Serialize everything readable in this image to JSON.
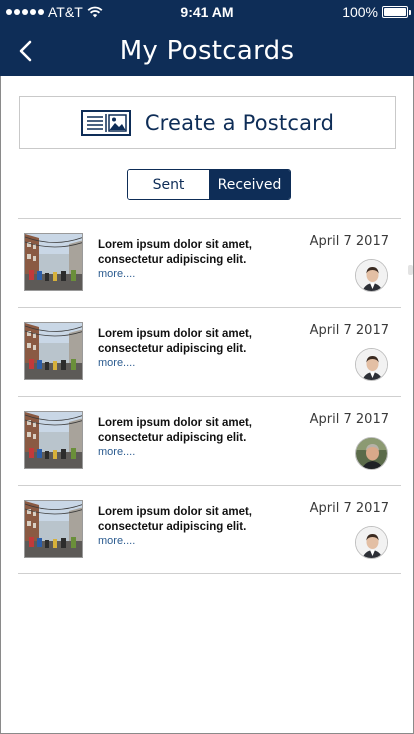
{
  "status": {
    "carrier": "AT&T",
    "time": "9:41 AM",
    "battery": "100%",
    "battery_level": 1.0
  },
  "nav": {
    "title": "My Postcards",
    "back_icon": "chevron-left-icon"
  },
  "create_button": {
    "label": "Create a Postcard",
    "icon": "postcard-icon"
  },
  "segment": {
    "options": [
      "Sent",
      "Received"
    ],
    "selected": "Received"
  },
  "postcards": [
    {
      "text": "Lorem ipsum dolor sit amet, consectetur adipiscing elit.",
      "more": "more....",
      "date": "April 7 2017",
      "avatar": "man-short-hair"
    },
    {
      "text": "Lorem ipsum dolor sit amet, consectetur adipiscing elit.",
      "more": "more....",
      "date": "April 7 2017",
      "avatar": "man-short-hair"
    },
    {
      "text": "Lorem ipsum dolor sit amet, consectetur adipiscing elit.",
      "more": "more....",
      "date": "April 7 2017",
      "avatar": "man-gray-hair"
    },
    {
      "text": "Lorem ipsum dolor sit amet, consectetur adipiscing elit.",
      "more": "more....",
      "date": "April 7 2017",
      "avatar": "man-short-hair"
    }
  ],
  "colors": {
    "brand": "#0e2d57",
    "link": "#2b5b8f",
    "divider": "#cfcfcf"
  }
}
